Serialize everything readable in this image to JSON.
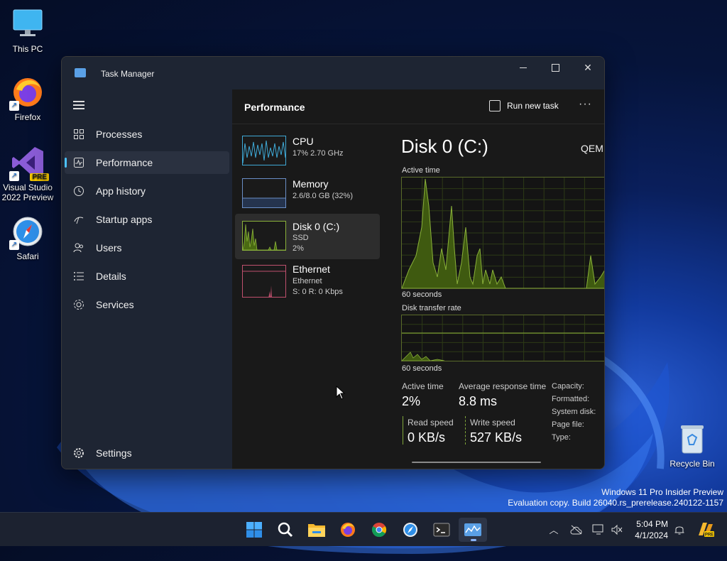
{
  "desktop": {
    "icons": [
      {
        "label": "This PC",
        "icon": "monitor-icon"
      },
      {
        "label": "Firefox",
        "icon": "firefox-icon"
      },
      {
        "label": "Visual Studio 2022 Preview",
        "icon": "visual-studio-icon",
        "badge": "PRE"
      },
      {
        "label": "Safari",
        "icon": "safari-icon"
      },
      {
        "label": "Recycle Bin",
        "icon": "recycle-bin-icon"
      }
    ],
    "watermark": {
      "line1": "Windows 11 Pro Insider Preview",
      "line2": "Evaluation copy. Build 26040.rs_prerelease.240122-1157"
    }
  },
  "window": {
    "title": "Task Manager",
    "sidebar": {
      "items": [
        {
          "label": "Processes",
          "icon": "processes-icon"
        },
        {
          "label": "Performance",
          "icon": "performance-icon",
          "active": true
        },
        {
          "label": "App history",
          "icon": "history-icon"
        },
        {
          "label": "Startup apps",
          "icon": "startup-icon"
        },
        {
          "label": "Users",
          "icon": "users-icon"
        },
        {
          "label": "Details",
          "icon": "details-icon"
        },
        {
          "label": "Services",
          "icon": "services-icon"
        }
      ],
      "settings": "Settings"
    },
    "header": {
      "title": "Performance",
      "run_new_task": "Run new task",
      "more": "···"
    },
    "tiles": [
      {
        "name": "CPU",
        "line1": "17%  2.70 GHz",
        "color": "#3fa9d6"
      },
      {
        "name": "Memory",
        "line1": "2.6/8.0 GB (32%)",
        "color": "#6a8ec6"
      },
      {
        "name": "Disk 0 (C:)",
        "line1": "SSD",
        "line2": "2%",
        "color": "#8ab13a"
      },
      {
        "name": "Ethernet",
        "line1": "Ethernet",
        "line2": "S: 0 R: 0 Kbps",
        "color": "#c0506e"
      }
    ],
    "detail": {
      "title": "Disk 0 (C:)",
      "model": "QEM",
      "active_time_label": "Active time",
      "active_time_span": "60 seconds",
      "transfer_rate_label": "Disk transfer rate",
      "transfer_rate_span": "60 seconds",
      "stats": {
        "active_time": {
          "label": "Active time",
          "value": "2%"
        },
        "avg_response": {
          "label": "Average response time",
          "value": "8.8 ms"
        },
        "read_speed": {
          "label": "Read speed",
          "value": "0 KB/s"
        },
        "write_speed": {
          "label": "Write speed",
          "value": "527 KB/s"
        }
      },
      "properties": [
        "Capacity:",
        "Formatted:",
        "System disk:",
        "Page file:",
        "Type:"
      ]
    }
  },
  "taskbar": {
    "apps": [
      "start-icon",
      "search-icon",
      "file-explorer-icon",
      "firefox-icon",
      "chrome-icon",
      "safari-icon",
      "terminal-icon",
      "task-manager-icon"
    ],
    "clock": {
      "time": "5:04 PM",
      "date": "4/1/2024"
    }
  }
}
